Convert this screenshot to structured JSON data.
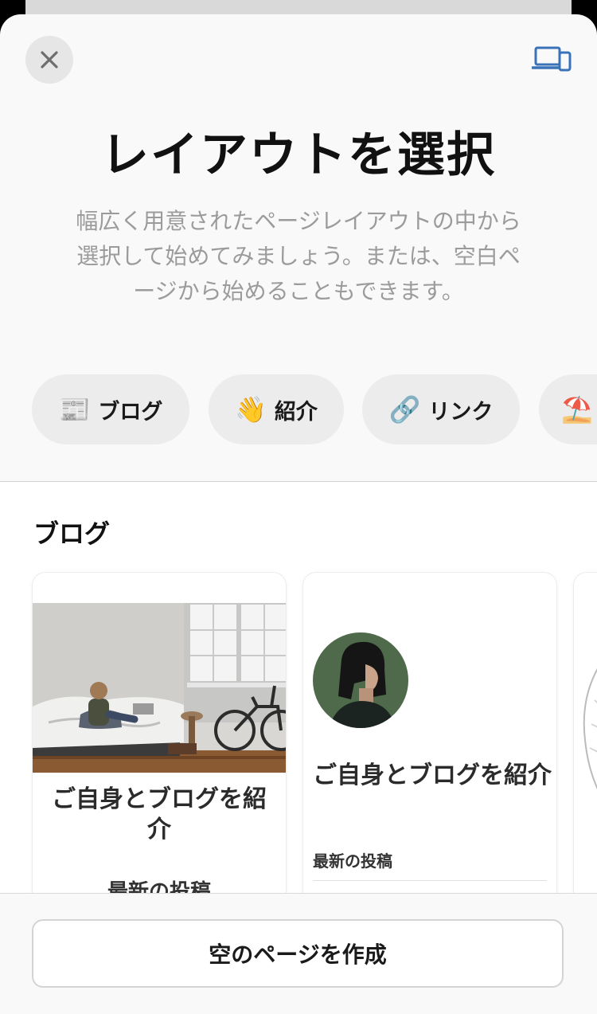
{
  "header": {
    "title": "レイアウトを選択",
    "subtitle": "幅広く用意されたページレイアウトの中から選択して始めてみましょう。または、空白ページから始めることもできます。"
  },
  "icons": {
    "close": "close-icon",
    "device_preview": "device-preview-icon",
    "accent_color": "#3a72b8"
  },
  "categories": [
    {
      "emoji": "📰",
      "label": "ブログ"
    },
    {
      "emoji": "👋",
      "label": "紹介"
    },
    {
      "emoji": "🔗",
      "label": "リンク"
    },
    {
      "emoji": "⛱️",
      "label": ""
    }
  ],
  "section": {
    "heading": "ブログ"
  },
  "cards": [
    {
      "title": "ご自身とブログを紹介",
      "subheading": "最新の投稿"
    },
    {
      "title": "ご自身とブログを紹介",
      "subheading": "最新の投稿"
    }
  ],
  "footer": {
    "create_blank": "空のページを作成"
  }
}
